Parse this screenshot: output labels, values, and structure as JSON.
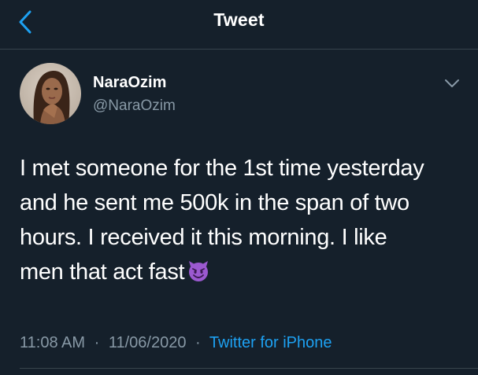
{
  "header": {
    "title": "Tweet",
    "back_icon": "chevron-left-icon"
  },
  "author": {
    "display_name": "NaraOzim",
    "handle": "@NaraOzim",
    "avatar": "avatar-photo"
  },
  "tweet": {
    "lines": [
      "I met someone for the 1st time yesterday",
      "and he sent me 500k in the span of two",
      "hours. I received it this morning. I like",
      "men that act fast"
    ],
    "emoji": "smiling-face-with-horns-emoji"
  },
  "meta": {
    "time": "11:08 AM",
    "date": "11/06/2020",
    "separator": "·",
    "source": "Twitter for iPhone"
  },
  "colors": {
    "background": "#15202b",
    "accent": "#1da1f2",
    "secondary_text": "#8899a6",
    "divider": "#38444d"
  },
  "icons": {
    "more": "chevron-down-icon"
  }
}
